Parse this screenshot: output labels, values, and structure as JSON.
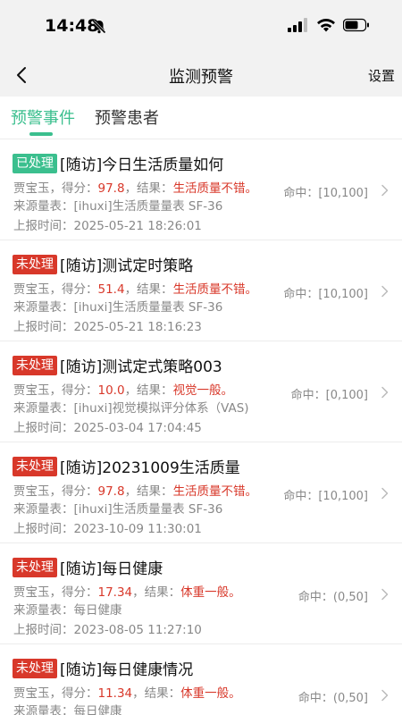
{
  "status_bar": {
    "time": "14:48"
  },
  "nav": {
    "title": "监测预警",
    "settings_label": "设置"
  },
  "tabs": [
    {
      "label": "预警事件"
    },
    {
      "label": "预警患者"
    }
  ],
  "labels": {
    "score_prefix": "，得分：",
    "result_prefix": "，结果：",
    "source_prefix": "来源量表：",
    "time_prefix": "上报时间：",
    "hit_prefix": "命中："
  },
  "colors": {
    "accent": "#3bbf8e",
    "alert": "#d8382a"
  },
  "events": [
    {
      "status": "已处理",
      "title": "[随访]今日生活质量如何",
      "patient": "贾宝玉",
      "score": "97.8",
      "result": "生活质量不错。",
      "source": "[ihuxi]生活质量量表 SF-36",
      "time": "2025-05-21 18:26:01",
      "hit": "[10,100]"
    },
    {
      "status": "未处理",
      "title": "[随访]测试定时策略",
      "patient": "贾宝玉",
      "score": "51.4",
      "result": "生活质量不错。",
      "source": "[ihuxi]生活质量量表 SF-36",
      "time": "2025-05-21 18:16:23",
      "hit": "[10,100]"
    },
    {
      "status": "未处理",
      "title": "[随访]测试定式策略003",
      "patient": "贾宝玉",
      "score": "10.0",
      "result": "视觉一般。",
      "source": "[ihuxi]视觉模拟评分体系（VAS)",
      "time": "2025-03-04 17:04:45",
      "hit": "[0,100]"
    },
    {
      "status": "未处理",
      "title": "[随访]20231009生活质量",
      "patient": "贾宝玉",
      "score": "97.8",
      "result": "生活质量不错。",
      "source": "[ihuxi]生活质量量表 SF-36",
      "time": "2023-10-09 11:30:01",
      "hit": "[10,100]"
    },
    {
      "status": "未处理",
      "title": "[随访]每日健康",
      "patient": "贾宝玉",
      "score": "17.34",
      "result": "体重一般。",
      "source": "每日健康",
      "time": "2023-08-05 11:27:10",
      "hit": "(0,50]"
    },
    {
      "status": "未处理",
      "title": "[随访]每日健康情况",
      "patient": "贾宝玉",
      "score": "11.34",
      "result": "体重一般。",
      "source": "每日健康",
      "time": "",
      "hit": "(0,50]"
    }
  ]
}
